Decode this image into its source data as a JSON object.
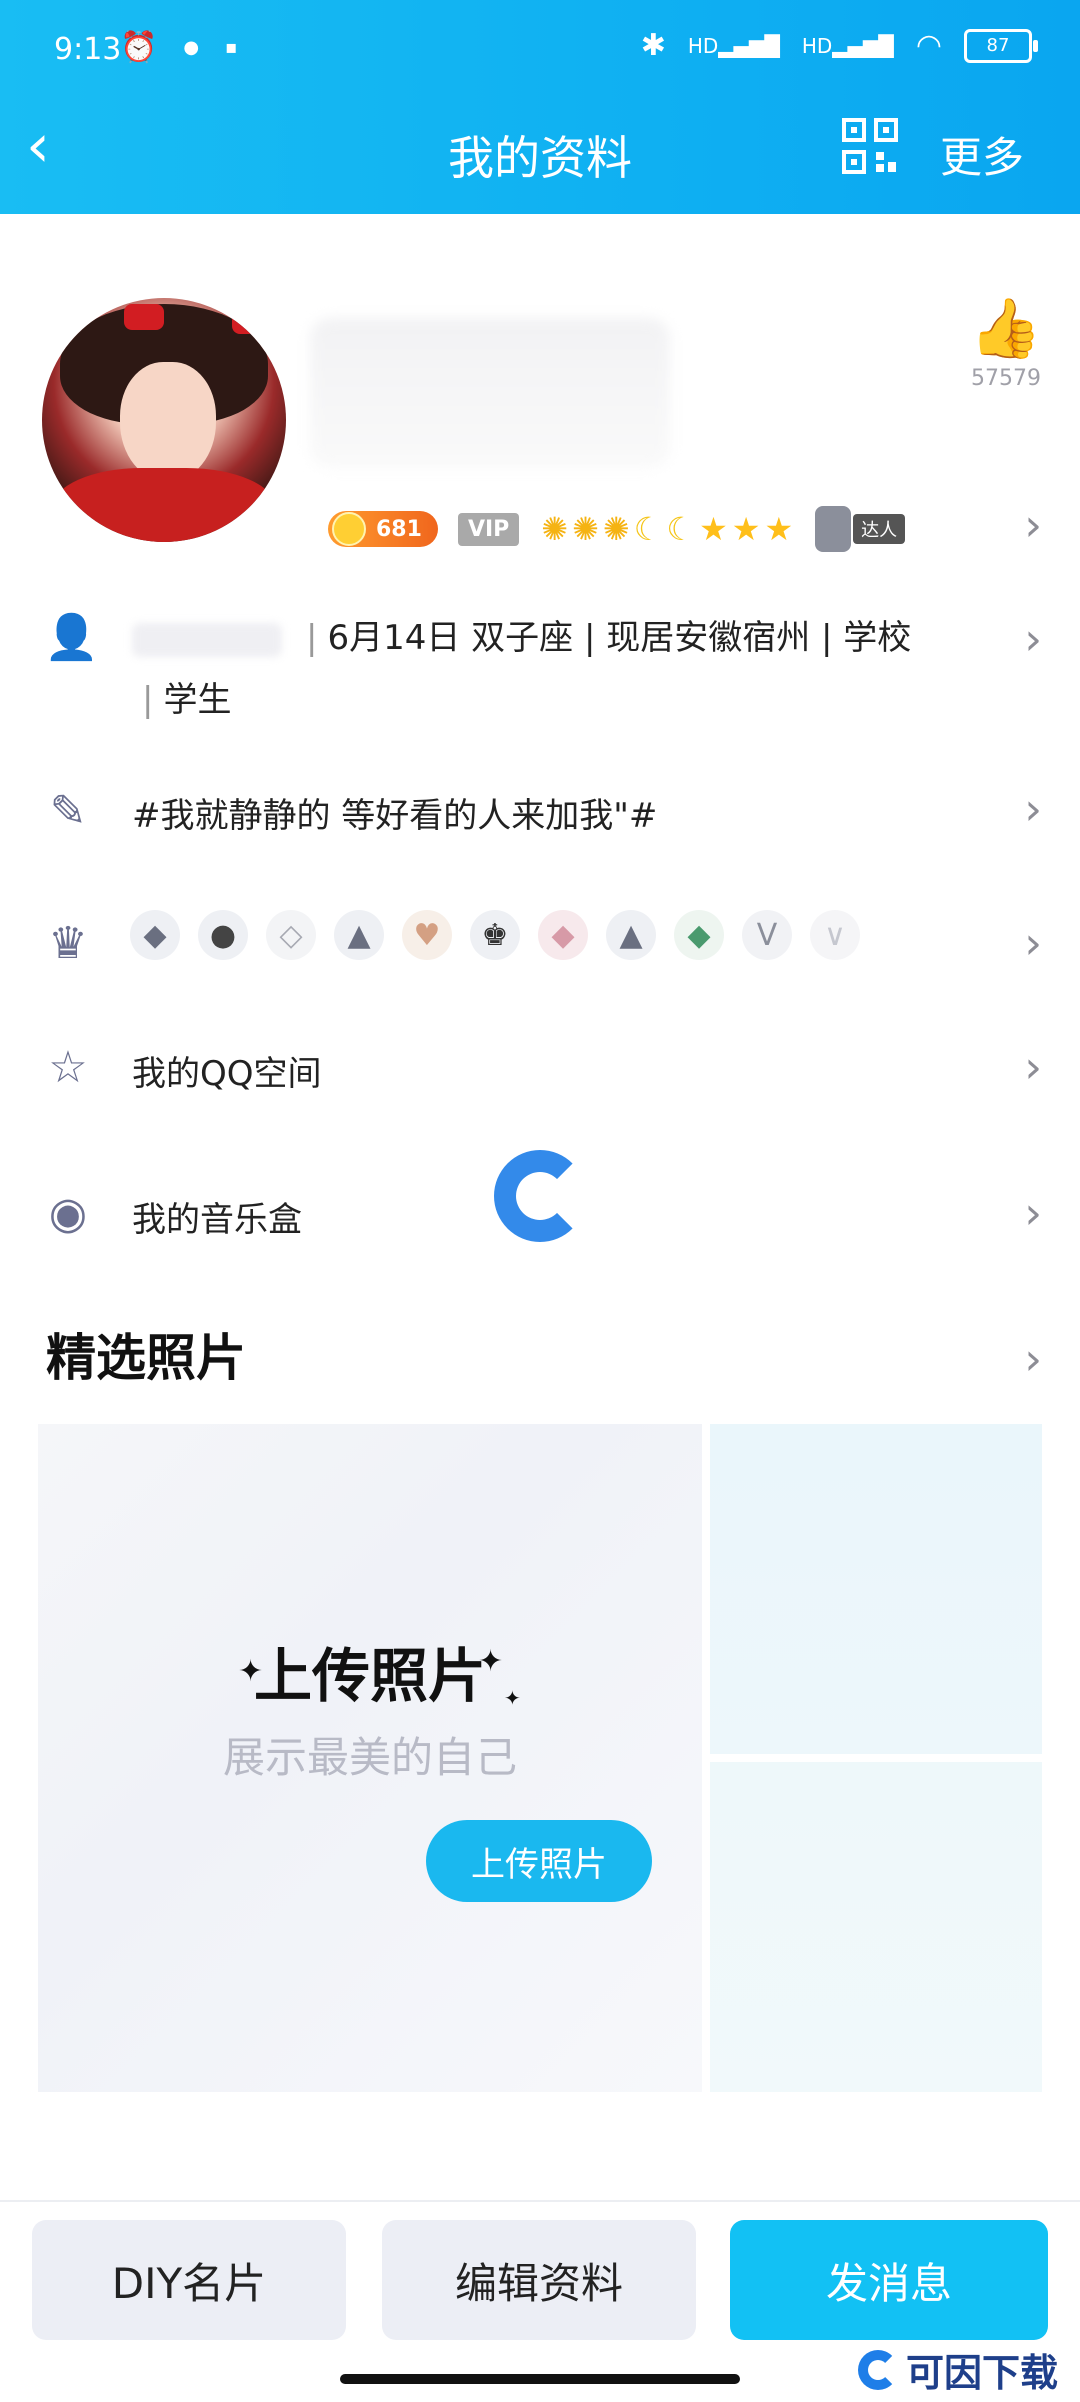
{
  "status": {
    "time": "9:13",
    "battery": "87",
    "signal_labels": [
      "HD",
      "HD"
    ]
  },
  "nav": {
    "back_icon": "chevron-left-icon",
    "title": "我的资料",
    "qr_icon": "qr-code-icon",
    "more": "更多"
  },
  "profile": {
    "like_count": "57579",
    "coin_count": "681",
    "vip_label": "VIP",
    "talent_label": "达人"
  },
  "rows": {
    "info_text": "6月14日 双子座 | 现居安徽宿州 | 学校",
    "info_text2": "学生",
    "signature": "#我就静静的 等好看的人来加我\"#",
    "qzone": "我的QQ空间",
    "music": "我的音乐盒"
  },
  "photos": {
    "section_title": "精选照片",
    "upload_title": "上传照片",
    "upload_sub": "展示最美的自己",
    "upload_button": "上传照片"
  },
  "bottom": {
    "diy": "DIY名片",
    "edit": "编辑资料",
    "message": "发消息"
  },
  "watermark": {
    "text": "可因下载"
  },
  "colors": {
    "header": "#12b2f2",
    "primary_button": "#12c1f4",
    "icon_gray": "#6b7090"
  }
}
